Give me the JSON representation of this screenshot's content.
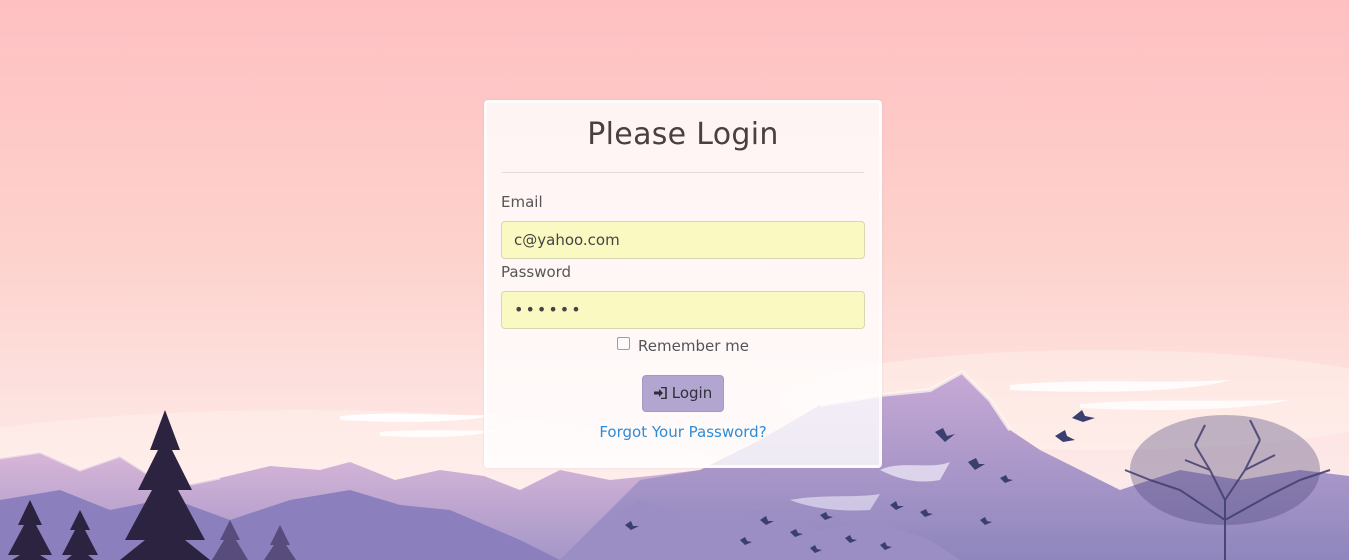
{
  "login": {
    "title": "Please Login",
    "email_label": "Email",
    "email_value": "c@yahoo.com",
    "password_label": "Password",
    "password_value": "••••••",
    "remember_label": "Remember me",
    "remember_checked": false,
    "submit_label": "Login",
    "submit_icon": "sign-in-icon",
    "forgot_label": "Forgot Your Password?"
  },
  "colors": {
    "sky_top": "#ffc0c2",
    "sky_bottom": "#fde7e6",
    "input_autofill": "#faf9c1",
    "button": "#b2a5d0",
    "link": "#2f8bd5",
    "mountain": "#b9a8d4"
  }
}
